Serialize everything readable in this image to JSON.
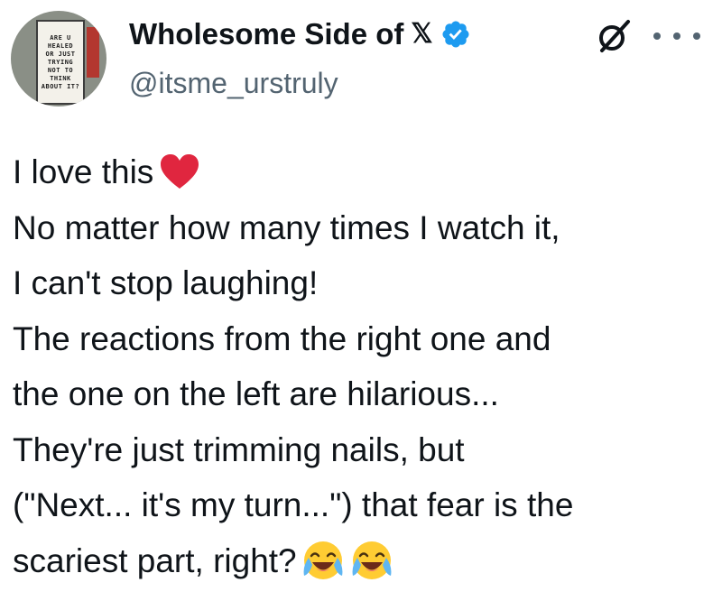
{
  "author": {
    "display_name": "Wholesome Side of",
    "x_logo": "𝕏",
    "handle": "@itsme_urstruly",
    "verified": true,
    "verified_color": "#1d9bf0",
    "avatar_sign_text": [
      "ARE U",
      "HEALED",
      "OR JUST",
      "TRYING",
      "NOT TO",
      "THINK",
      "ABOUT IT?"
    ]
  },
  "header_icons": {
    "grok": "grok-icon",
    "more": "more-options-icon"
  },
  "tweet": {
    "lines": [
      "I love this",
      "No matter how many times I watch it,",
      "I can't stop laughing!",
      "The reactions from the right one and",
      "the one on the left are hilarious...",
      "They're just trimming nails, but",
      "(\"Next... it's my turn...\") that fear is the",
      "scariest part, right?"
    ],
    "heart_emoji": "heart-icon",
    "laughing_emoji": "face-with-tears-of-joy-icon",
    "laughing_emoji_count": 2
  },
  "colors": {
    "text": "#0f1419",
    "secondary_text": "#536471",
    "heart": "#e0263f",
    "emoji_face": "#ffcc33"
  }
}
